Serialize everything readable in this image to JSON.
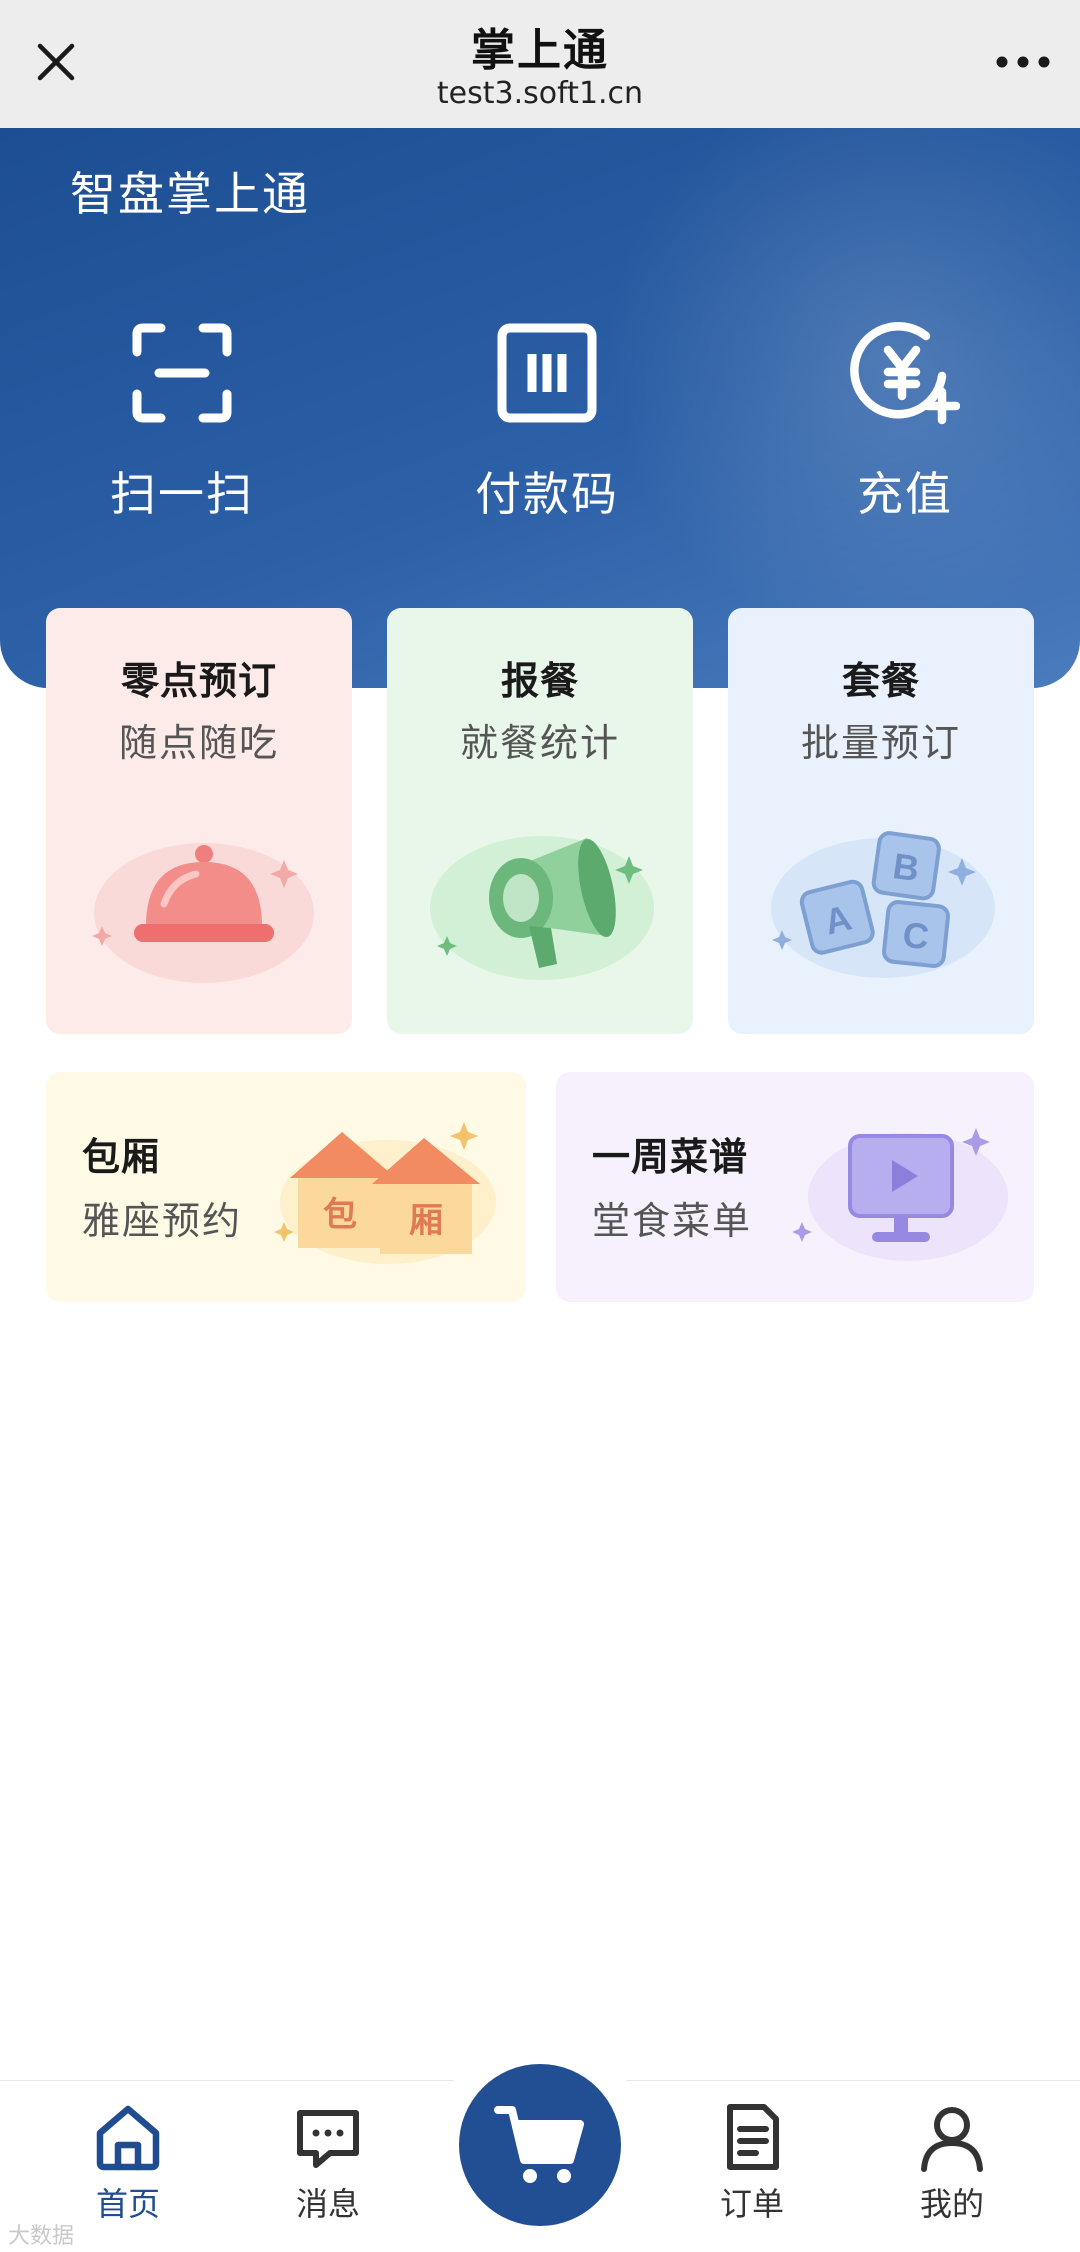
{
  "browser": {
    "title": "掌上通",
    "url": "test3.soft1.cn",
    "close_icon": "close-icon",
    "more_icon": "more-icon"
  },
  "header": {
    "app_name": "智盘掌上通",
    "actions": [
      {
        "label": "扫一扫",
        "icon": "scan-icon"
      },
      {
        "label": "付款码",
        "icon": "payment-code-icon"
      },
      {
        "label": "充值",
        "icon": "recharge-yuan-icon"
      }
    ]
  },
  "cards": [
    {
      "title": "零点预订",
      "subtitle": "随点随吃",
      "icon": "food-cloche-icon",
      "color": "#fdebe9"
    },
    {
      "title": "报餐",
      "subtitle": "就餐统计",
      "icon": "megaphone-icon",
      "color": "#e8f7ea"
    },
    {
      "title": "套餐",
      "subtitle": "批量预订",
      "icon": "abc-blocks-icon",
      "color": "#e8f1fc"
    },
    {
      "title": "包厢",
      "subtitle": "雅座预约",
      "icon": "private-room-house-icon",
      "color": "#fffae6",
      "illustration_text": [
        "包",
        "厢"
      ]
    },
    {
      "title": "一周菜谱",
      "subtitle": "堂食菜单",
      "icon": "menu-screen-icon",
      "color": "#f6f1fc"
    }
  ],
  "tabbar": {
    "tabs": [
      {
        "label": "首页",
        "icon": "home-icon",
        "active": true
      },
      {
        "label": "消息",
        "icon": "message-icon",
        "active": false
      },
      {
        "label": "订单",
        "icon": "order-icon",
        "active": false
      },
      {
        "label": "我的",
        "icon": "user-icon",
        "active": false
      }
    ],
    "center_icon": "shopping-cart-icon",
    "active_color": "#1f4d8f"
  },
  "watermark": "大数据"
}
